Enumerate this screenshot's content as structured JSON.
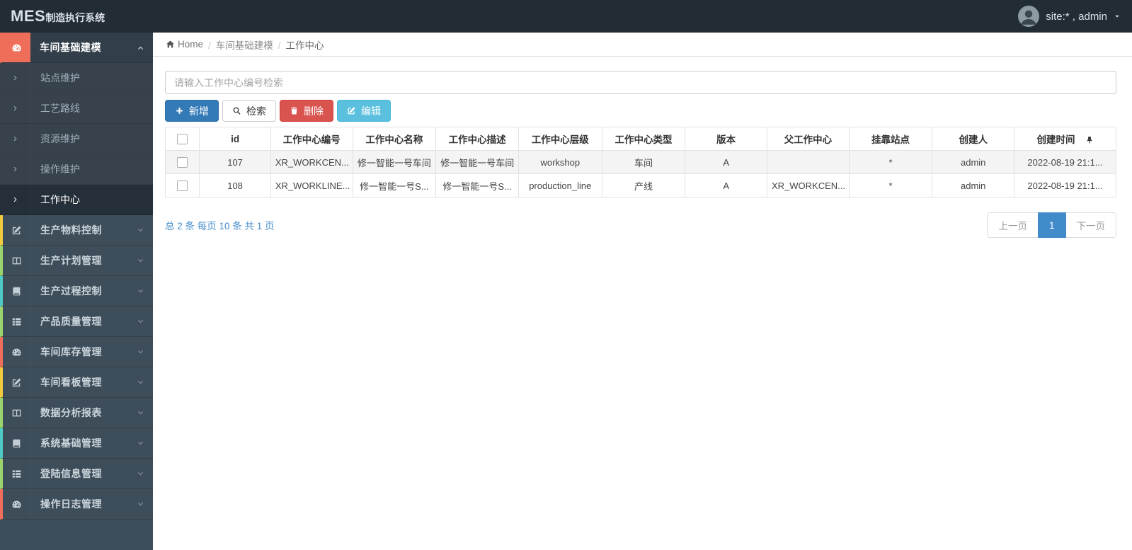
{
  "navbar": {
    "logo_primary": "MES",
    "logo_secondary": "制造执行系统",
    "user": "site:* , admin",
    "user_caret_icon": "caret-down-icon",
    "avatar_icon": "user-avatar"
  },
  "breadcrumb": {
    "home": "Home",
    "home_icon": "home-icon",
    "items": [
      "车间基础建模",
      "工作中心"
    ]
  },
  "search": {
    "placeholder": "请输入工作中心编号检索",
    "value": ""
  },
  "toolbar": {
    "buttons": [
      {
        "name": "add-button",
        "label": "新增",
        "icon": "plus-icon",
        "style": "primary"
      },
      {
        "name": "search-button",
        "label": "检索",
        "icon": "search-icon",
        "style": "default"
      },
      {
        "name": "delete-button",
        "label": "删除",
        "icon": "trash-icon",
        "style": "danger"
      },
      {
        "name": "edit-button",
        "label": "编辑",
        "icon": "edit-icon",
        "style": "info"
      }
    ]
  },
  "sidebar": {
    "menu": [
      {
        "label": "车间基础建模",
        "icon": "dashboard-icon",
        "accent": "#ee6e5a",
        "active": true,
        "expanded": true,
        "children": [
          {
            "label": "站点维护"
          },
          {
            "label": "工艺路线"
          },
          {
            "label": "资源维护"
          },
          {
            "label": "操作维护"
          },
          {
            "label": "工作中心",
            "selected": true
          }
        ]
      },
      {
        "label": "生产物料控制",
        "icon": "edit-icon",
        "accent": "#f2c93f"
      },
      {
        "label": "生产计划管理",
        "icon": "columns-icon",
        "accent": "#9bd46d"
      },
      {
        "label": "生产过程控制",
        "icon": "book-icon",
        "accent": "#4fc9c4"
      },
      {
        "label": "产品质量管理",
        "icon": "list-icon",
        "accent": "#9bd46d"
      },
      {
        "label": "车间库存管理",
        "icon": "dashboard-icon",
        "accent": "#ee6e5a"
      },
      {
        "label": "车间看板管理",
        "icon": "edit-icon",
        "accent": "#f2c93f"
      },
      {
        "label": "数据分析报表",
        "icon": "columns-icon",
        "accent": "#9bd46d"
      },
      {
        "label": "系统基础管理",
        "icon": "book-icon",
        "accent": "#4fc9c4"
      },
      {
        "label": "登陆信息管理",
        "icon": "list-icon",
        "accent": "#9bd46d"
      },
      {
        "label": "操作日志管理",
        "icon": "dashboard-icon",
        "accent": "#ee6e5a"
      }
    ]
  },
  "table": {
    "header_pin_icon": "pin-icon",
    "columns": [
      "id",
      "工作中心编号",
      "工作中心名称",
      "工作中心描述",
      "工作中心层级",
      "工作中心类型",
      "版本",
      "父工作中心",
      "挂靠站点",
      "创建人",
      "创建时间"
    ],
    "rows": [
      [
        "107",
        "XR_WORKCEN...",
        "修一智能一号车间",
        "修一智能一号车间",
        "workshop",
        "车间",
        "A",
        "",
        "*",
        "admin",
        "2022-08-19 21:1..."
      ],
      [
        "108",
        "XR_WORKLINE...",
        "修一智能一号S...",
        "修一智能一号S...",
        "production_line",
        "产线",
        "A",
        "XR_WORKCEN...",
        "*",
        "admin",
        "2022-08-19 21:1..."
      ]
    ]
  },
  "pagination": {
    "summary": "总 2 条 每页 10 条 共 1 页",
    "prev": "上一页",
    "current": "1",
    "next": "下一页"
  },
  "colors": {
    "navbar_bg": "#222c35",
    "sidebar_bg": "#3e4d5a",
    "active_accent": "#ee6e5a",
    "primary_blue": "#337ab7",
    "danger_red": "#d9534f",
    "info_cyan": "#5bc0de",
    "pagination_blue": "#428bca"
  }
}
